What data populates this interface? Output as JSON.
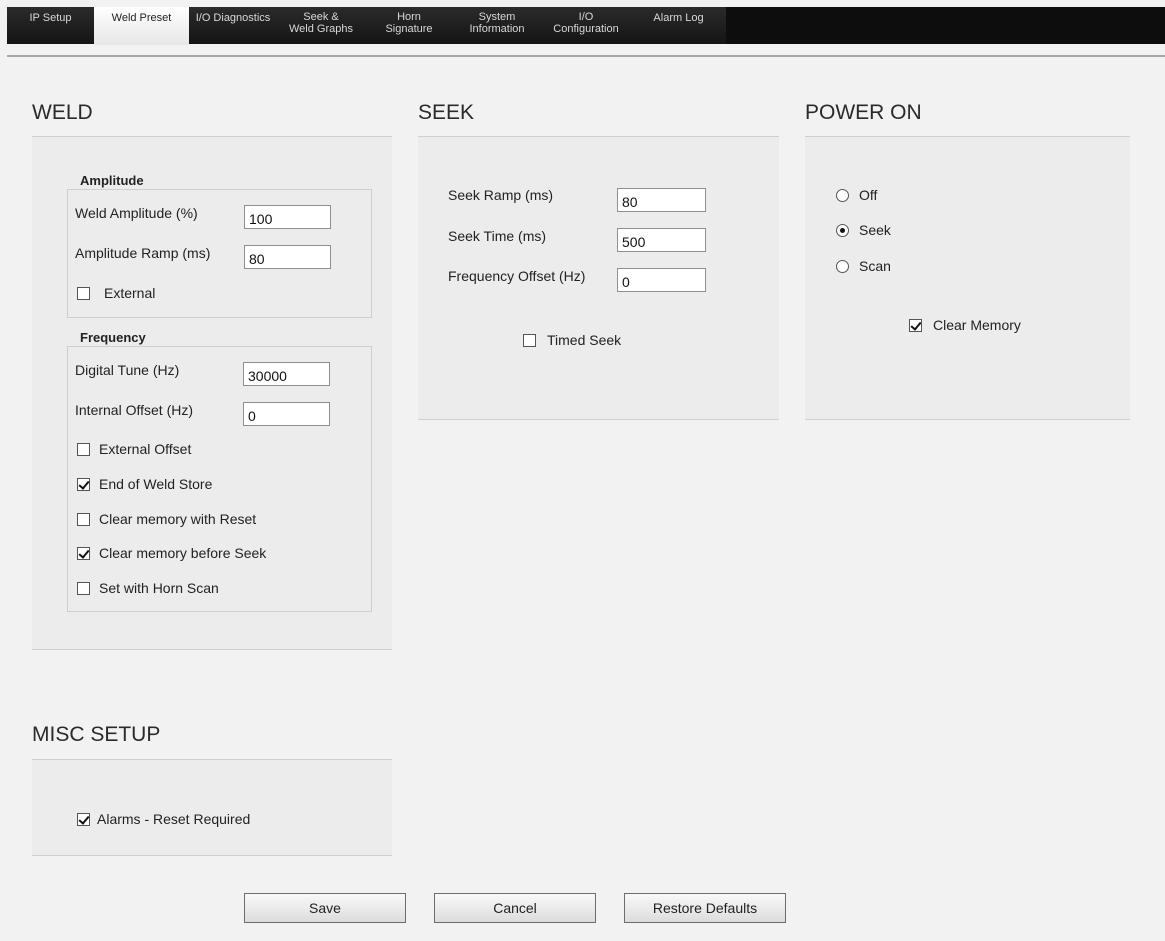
{
  "tabs": [
    {
      "line1": "IP Setup",
      "line2": ""
    },
    {
      "line1": "Weld Preset",
      "line2": ""
    },
    {
      "line1": "I/O Diagnostics",
      "line2": ""
    },
    {
      "line1": "Seek &",
      "line2": "Weld Graphs"
    },
    {
      "line1": "Horn",
      "line2": "Signature"
    },
    {
      "line1": "System",
      "line2": "Information"
    },
    {
      "line1": "I/O",
      "line2": "Configuration"
    },
    {
      "line1": "Alarm Log",
      "line2": ""
    }
  ],
  "active_tab": "Weld Preset",
  "weld": {
    "title": "WELD",
    "amplitude": {
      "title": "Amplitude",
      "weld_amplitude_label": "Weld Amplitude (%)",
      "weld_amplitude_value": "100",
      "amplitude_ramp_label": "Amplitude Ramp (ms)",
      "amplitude_ramp_value": "80",
      "external_label": "External",
      "external_checked": false
    },
    "frequency": {
      "title": "Frequency",
      "digital_tune_label": "Digital Tune (Hz)",
      "digital_tune_value": "30000",
      "internal_offset_label": "Internal Offset (Hz)",
      "internal_offset_value": "0",
      "options": [
        {
          "label": "External Offset",
          "checked": false
        },
        {
          "label": "End of Weld Store",
          "checked": true
        },
        {
          "label": "Clear memory with Reset",
          "checked": false
        },
        {
          "label": "Clear memory before Seek",
          "checked": true
        },
        {
          "label": "Set with Horn Scan",
          "checked": false
        }
      ]
    }
  },
  "seek": {
    "title": "SEEK",
    "seek_ramp_label": "Seek Ramp (ms)",
    "seek_ramp_value": "80",
    "seek_time_label": "Seek Time (ms)",
    "seek_time_value": "500",
    "frequency_offset_label": "Frequency Offset (Hz)",
    "frequency_offset_value": "0",
    "timed_seek_label": "Timed Seek",
    "timed_seek_checked": false
  },
  "power_on": {
    "title": "POWER ON",
    "options": [
      {
        "label": "Off",
        "selected": false
      },
      {
        "label": "Seek",
        "selected": true
      },
      {
        "label": "Scan",
        "selected": false
      }
    ],
    "clear_memory_label": "Clear Memory",
    "clear_memory_checked": true
  },
  "misc": {
    "title": "MISC SETUP",
    "alarms_label": "Alarms - Reset Required",
    "alarms_checked": true
  },
  "buttons": {
    "save": "Save",
    "cancel": "Cancel",
    "restore": "Restore Defaults"
  }
}
